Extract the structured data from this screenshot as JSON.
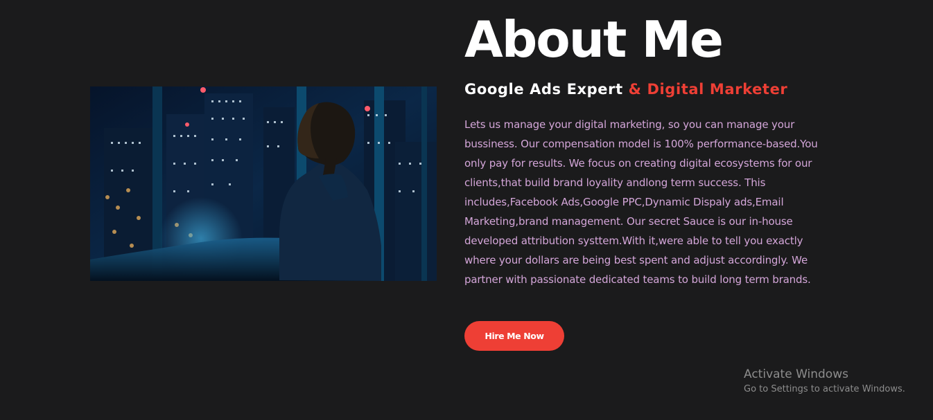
{
  "about": {
    "title": "About Me",
    "subtitle_main": "Google Ads Expert",
    "subtitle_accent": "& Digital Marketer",
    "paragraph_lines": [
      "Lets us manage your digital marketing, so you can manage your",
      "bussiness. Our compensation model is 100% performance-based.You",
      "only pay for results. We focus on creating digital ecosystems for our",
      "clients,that build brand loyality andlong term success. This",
      "includes,Facebook Ads,Google PPC,Dynamic Dispaly ads,Email",
      "Marketing,brand management. Our secret Sauce is our in-house",
      "developed attribution systtem.With it,were able to tell you exactly",
      "where your dollars are being best spent and adjust accordingly. We",
      "partner with passionate dedicated teams to build long term brands."
    ],
    "hire_button_label": "Hire Me Now",
    "colors": {
      "background": "#1b1b1c",
      "accent": "#ee3f35",
      "body_text": "#d4a6d9",
      "heading": "#ffffff"
    }
  },
  "windows_watermark": {
    "title": "Activate Windows",
    "subtitle": "Go to Settings to activate Windows."
  }
}
